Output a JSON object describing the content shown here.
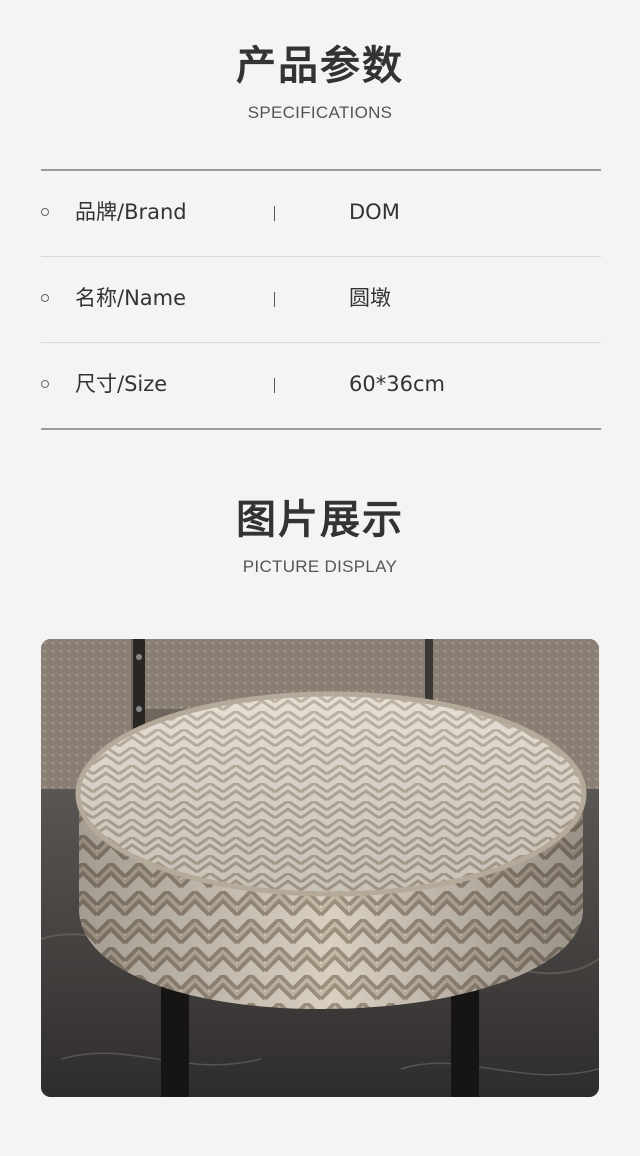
{
  "specifications": {
    "title": "产品参数",
    "subtitle": "SPECIFICATIONS",
    "rows": [
      {
        "label": "品牌/Brand",
        "value": "DOM"
      },
      {
        "label": "名称/Name",
        "value": "圆墩"
      },
      {
        "label": "尺寸/Size",
        "value": "60*36cm"
      }
    ]
  },
  "display": {
    "title": "图片展示",
    "subtitle": "PICTURE DISPLAY",
    "image_subject": "round upholstered ottoman with beige geometric chevron fabric"
  },
  "colors": {
    "background": "#f4f4f4",
    "text": "#333333",
    "rule": "#9a9a9a"
  }
}
